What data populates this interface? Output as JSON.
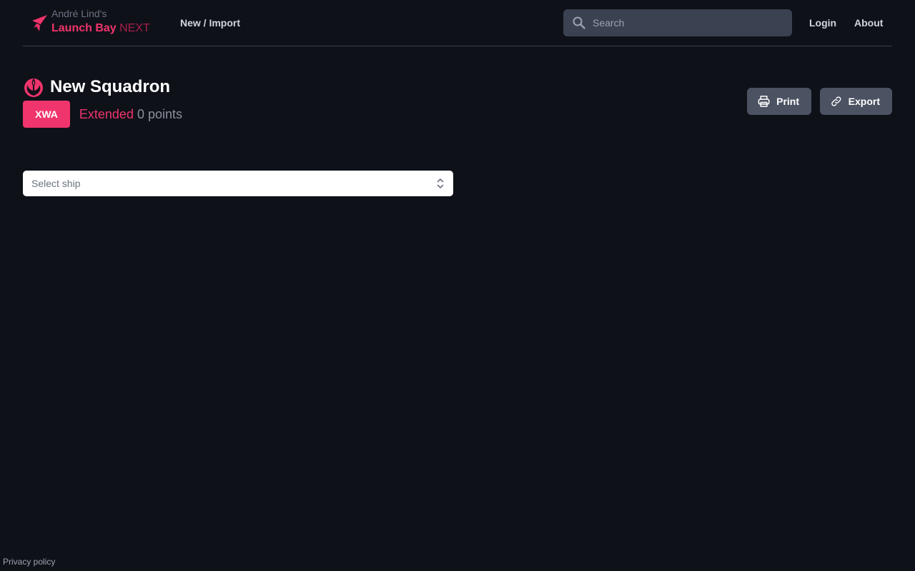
{
  "header": {
    "brand_sub": "André Lind's",
    "brand_name": "Launch Bay",
    "brand_suffix": "NEXT",
    "nav_new_import": "New / Import",
    "search_placeholder": "Search",
    "nav_login": "Login",
    "nav_about": "About"
  },
  "squadron": {
    "title": "New Squadron",
    "format_badge": "XWA",
    "format_label": "Extended",
    "points": "0 points",
    "faction_icon": "rebel-alliance-icon"
  },
  "actions": {
    "print_label": "Print",
    "export_label": "Export"
  },
  "ship_select": {
    "value": "Select ship"
  },
  "footer": {
    "privacy_label": "Privacy policy"
  },
  "colors": {
    "background": "#0f1119",
    "accent": "#f0346c",
    "button": "#4b5262",
    "search_bg": "#3a4151"
  }
}
